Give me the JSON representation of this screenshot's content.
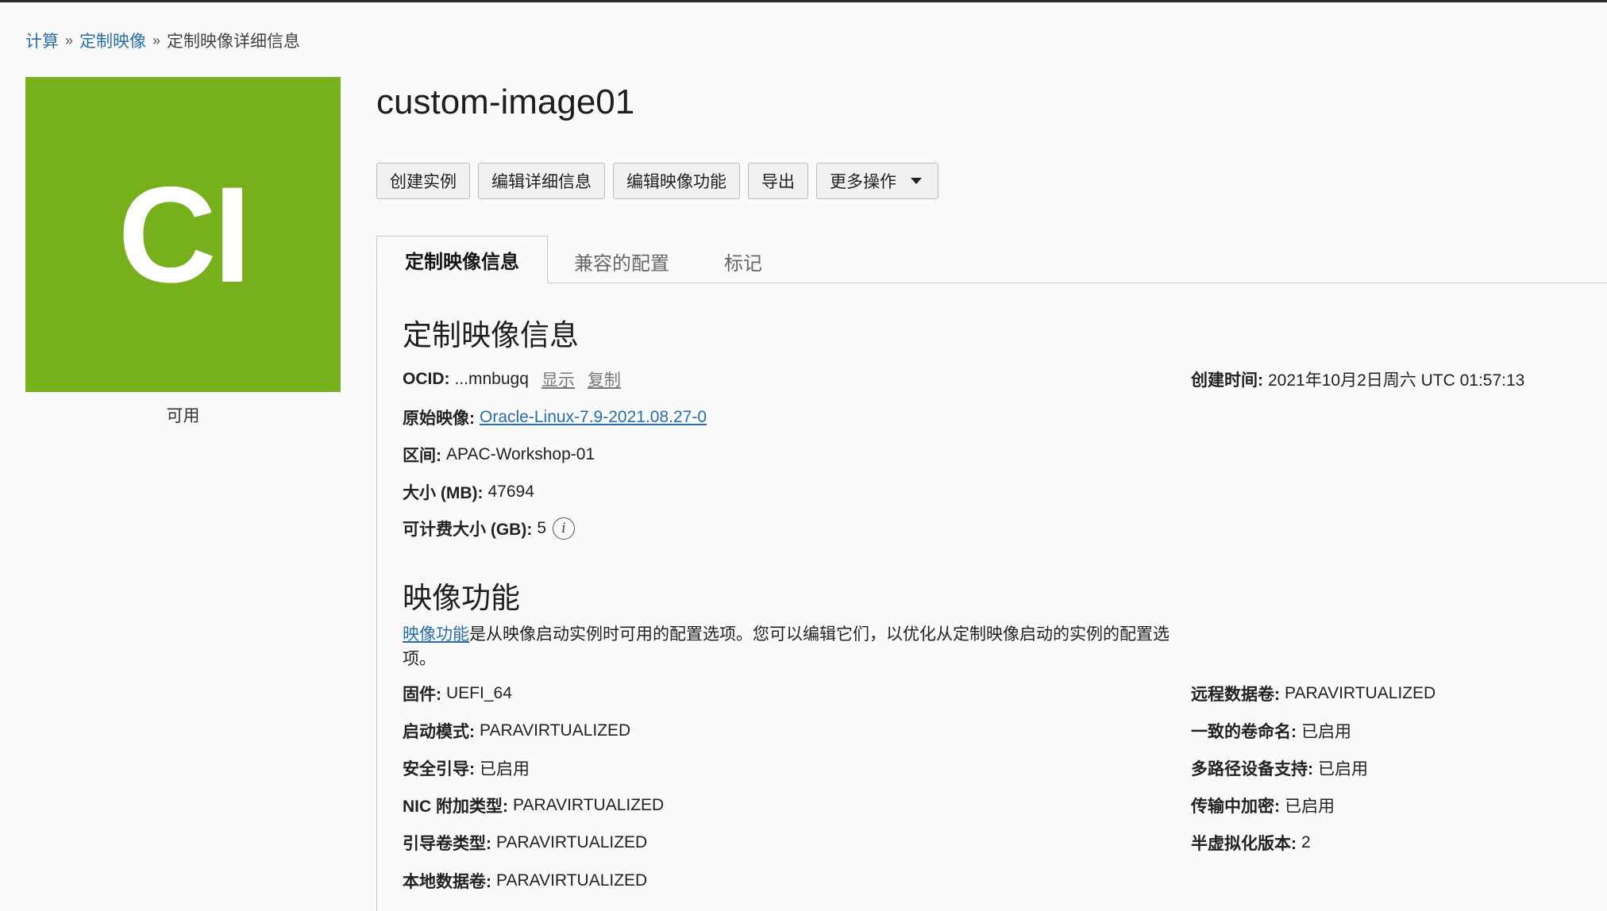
{
  "breadcrumb": {
    "home": "计算",
    "parent": "定制映像",
    "current": "定制映像详细信息",
    "sep": "»"
  },
  "tile": {
    "abbr": "CI",
    "state": "可用",
    "color": "#76b01d"
  },
  "title": "custom-image01",
  "actions": {
    "create": "创建实例",
    "edit_details": "编辑详细信息",
    "edit_capabilities": "编辑映像功能",
    "export": "导出",
    "more": "更多操作"
  },
  "tabs": {
    "info": "定制映像信息",
    "compat": "兼容的配置",
    "tags": "标记"
  },
  "info": {
    "heading": "定制映像信息",
    "ocid_label": "OCID:",
    "ocid_value": "...mnbugq",
    "show": "显示",
    "copy": "复制",
    "created_label": "创建时间:",
    "created_value": "2021年10月2日周六 UTC 01:57:13",
    "base_label": "原始映像:",
    "base_value": "Oracle-Linux-7.9-2021.08.27-0",
    "compartment_label": "区间:",
    "compartment_value": "APAC-Workshop-01",
    "size_label": "大小 (MB):",
    "size_value": "47694",
    "billable_label": "可计费大小 (GB):",
    "billable_value": "5",
    "info_icon": "i"
  },
  "capabilities": {
    "heading": "映像功能",
    "desc_link": "映像功能",
    "desc_text": "是从映像启动实例时可用的配置选项。您可以编辑它们，以优化从定制映像启动的实例的配置选项。",
    "firmware_label": "固件:",
    "firmware_value": "UEFI_64",
    "launch_label": "启动模式:",
    "launch_value": "PARAVIRTUALIZED",
    "secure_label": "安全引导:",
    "secure_value": "已启用",
    "nic_label": "NIC 附加类型:",
    "nic_value": "PARAVIRTUALIZED",
    "bootvol_label": "引导卷类型:",
    "bootvol_value": "PARAVIRTUALIZED",
    "localdata_label": "本地数据卷:",
    "localdata_value": "PARAVIRTUALIZED",
    "remote_label": "远程数据卷:",
    "remote_value": "PARAVIRTUALIZED",
    "consistent_label": "一致的卷命名:",
    "consistent_value": "已启用",
    "multipath_label": "多路径设备支持:",
    "multipath_value": "已启用",
    "transit_label": "传输中加密:",
    "transit_value": "已启用",
    "pv_label": "半虚拟化版本:",
    "pv_value": "2"
  }
}
